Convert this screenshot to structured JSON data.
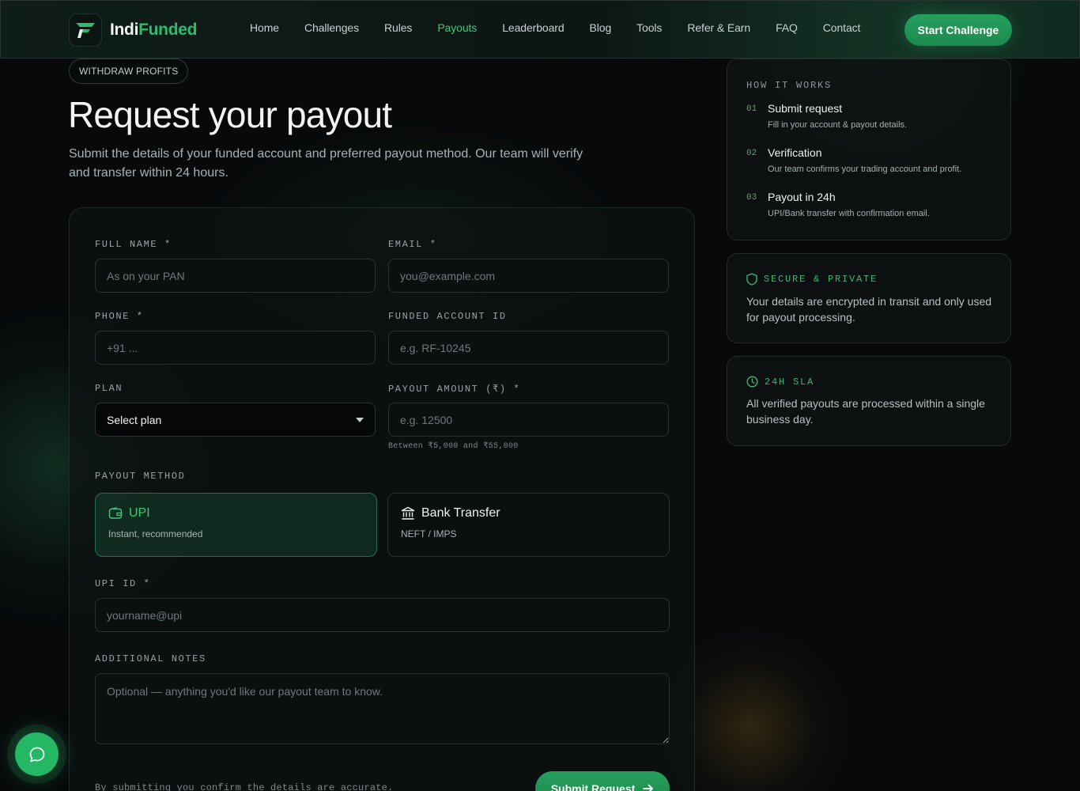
{
  "brand": {
    "name_part1": "Indi",
    "name_part2": "Funded",
    "accent": "#2bbd6e"
  },
  "nav": {
    "items": [
      "Home",
      "Challenges",
      "Rules",
      "Payouts",
      "Leaderboard",
      "Blog",
      "Tools",
      "Refer & Earn",
      "FAQ",
      "Contact"
    ],
    "active": "Payouts",
    "cta": "Start Challenge"
  },
  "hero": {
    "badge": "WITHDRAW PROFITS",
    "title": "Request your payout",
    "subtitle": "Submit the details of your funded account and preferred payout method. Our team will verify and transfer within 24 hours."
  },
  "form": {
    "full_name": {
      "label": "FULL NAME *",
      "placeholder": "As on your PAN"
    },
    "email": {
      "label": "EMAIL *",
      "placeholder": "you@example.com"
    },
    "phone": {
      "label": "PHONE *",
      "placeholder": "+91 ..."
    },
    "account_id": {
      "label": "FUNDED ACCOUNT ID",
      "placeholder": "e.g. RF-10245"
    },
    "plan": {
      "label": "PLAN",
      "value": "Select plan"
    },
    "amount": {
      "label": "PAYOUT AMOUNT (₹) *",
      "placeholder": "e.g. 12500",
      "hint": "Between ₹5,000 and ₹55,000"
    },
    "method": {
      "label": "PAYOUT METHOD",
      "options": [
        {
          "title": "UPI",
          "subtitle": "Instant, recommended",
          "icon": "wallet-icon",
          "selected": true
        },
        {
          "title": "Bank Transfer",
          "subtitle": "NEFT / IMPS",
          "icon": "bank-icon",
          "selected": false
        }
      ]
    },
    "upi_id": {
      "label": "UPI ID *",
      "placeholder": "yourname@upi"
    },
    "notes": {
      "label": "ADDITIONAL NOTES",
      "placeholder": "Optional — anything you'd like our payout team to know."
    },
    "consent": "By submitting you confirm the details are accurate.",
    "submit": "Submit Request"
  },
  "how_it_works": {
    "heading": "HOW IT WORKS",
    "steps": [
      {
        "num": "01",
        "title": "Submit request",
        "desc": "Fill in your account & payout details."
      },
      {
        "num": "02",
        "title": "Verification",
        "desc": "Our team confirms your trading account and profit."
      },
      {
        "num": "03",
        "title": "Payout in 24h",
        "desc": "UPI/Bank transfer with confirmation email."
      }
    ]
  },
  "secure": {
    "heading": "SECURE & PRIVATE",
    "icon": "shield-icon",
    "text": "Your details are encrypted in transit and only used for payout processing."
  },
  "sla": {
    "heading": "24H SLA",
    "icon": "clock-icon",
    "text": "All verified payouts are processed within a single business day."
  },
  "chat": {
    "icon": "chat-icon"
  }
}
